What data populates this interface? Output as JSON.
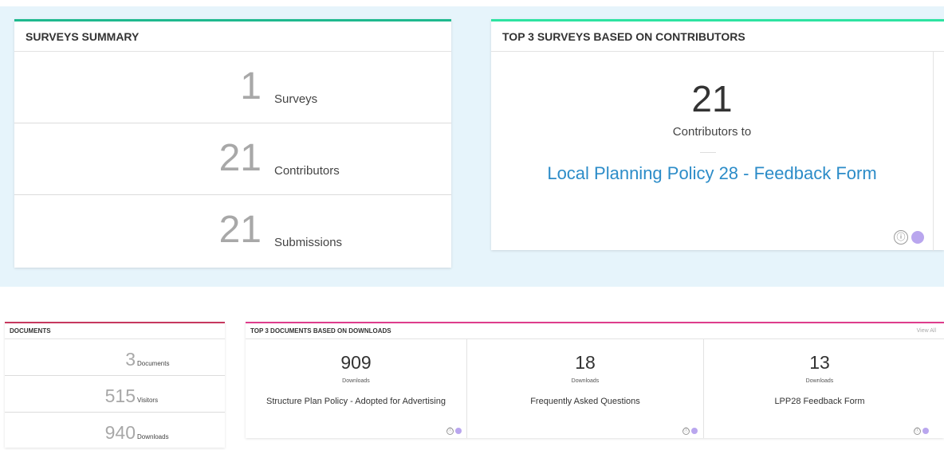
{
  "surveys_summary": {
    "title": "SURVEYS SUMMARY",
    "stats": [
      {
        "value": "1",
        "label": "Surveys"
      },
      {
        "value": "21",
        "label": "Contributors"
      },
      {
        "value": "21",
        "label": "Submissions"
      }
    ]
  },
  "top_surveys": {
    "title": "TOP 3 SURVEYS BASED ON CONTRIBUTORS",
    "count": "21",
    "count_label": "Contributors to",
    "survey_link": "Local Planning Policy 28 - Feedback Form",
    "info_icon": "ⓘ"
  },
  "documents": {
    "title": "DOCUMENTS",
    "stats": [
      {
        "value": "3",
        "label": "Documents"
      },
      {
        "value": "515",
        "label": "Visitors"
      },
      {
        "value": "940",
        "label": "Downloads"
      }
    ]
  },
  "top_documents": {
    "title": "TOP 3 DOCUMENTS BASED ON DOWNLOADS",
    "view_all": "View All",
    "info_icon": "ⓘ",
    "items": [
      {
        "value": "909",
        "label": "Downloads",
        "name": "Structure Plan Policy - Adopted for Advertising"
      },
      {
        "value": "18",
        "label": "Downloads",
        "name": "Frequently Asked Questions"
      },
      {
        "value": "13",
        "label": "Downloads",
        "name": "LPP28 Feedback Form"
      }
    ]
  },
  "colors": {
    "survey_accent": "#1fb98e",
    "top3_accent": "#2ee3a1",
    "docs_accent": "#c6385e",
    "docs3_accent": "#de3d8c",
    "link": "#2c8cc8",
    "dot": "#b9a6ee"
  }
}
